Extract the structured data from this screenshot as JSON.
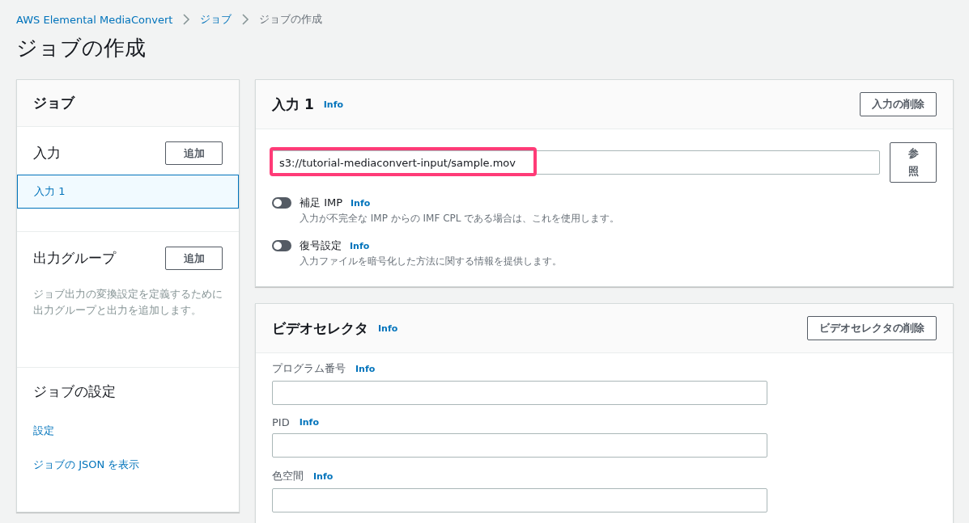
{
  "breadcrumbs": [
    {
      "label": "AWS Elemental MediaConvert",
      "link": true
    },
    {
      "label": "ジョブ",
      "link": true
    },
    {
      "label": "ジョブの作成",
      "link": false
    }
  ],
  "page_title": "ジョブの作成",
  "sidebar": {
    "title": "ジョブ",
    "sections": [
      {
        "title": "入力",
        "button": "追加",
        "items": [
          {
            "label": "入力 1",
            "selected": true
          }
        ]
      },
      {
        "title": "出力グループ",
        "button": "追加",
        "description": "ジョブ出力の変換設定を定義するために出力グループと出力を追加します。"
      },
      {
        "title": "ジョブの設定",
        "links": [
          "設定",
          "ジョブの JSON を表示"
        ]
      }
    ]
  },
  "input_panel": {
    "title": "入力 1",
    "info": "Info",
    "delete_button": "入力の削除",
    "file_value": "s3://tutorial-mediaconvert-input/sample.mov",
    "highlighted": true,
    "browse_button": "参照",
    "toggles": [
      {
        "label": "補足 IMP",
        "info": "Info",
        "description": "入力が不完全な IMP からの IMF CPL である場合は、これを使用します。",
        "on": false
      },
      {
        "label": "復号設定",
        "info": "Info",
        "description": "入力ファイルを暗号化した方法に関する情報を提供します。",
        "on": false
      }
    ]
  },
  "video_selector_panel": {
    "title": "ビデオセレクタ",
    "info": "Info",
    "delete_button": "ビデオセレクタの削除",
    "fields": [
      {
        "label": "プログラム番号",
        "info": "Info"
      },
      {
        "label": "PID",
        "info": "Info"
      },
      {
        "label": "色空間",
        "info": "Info"
      }
    ]
  }
}
